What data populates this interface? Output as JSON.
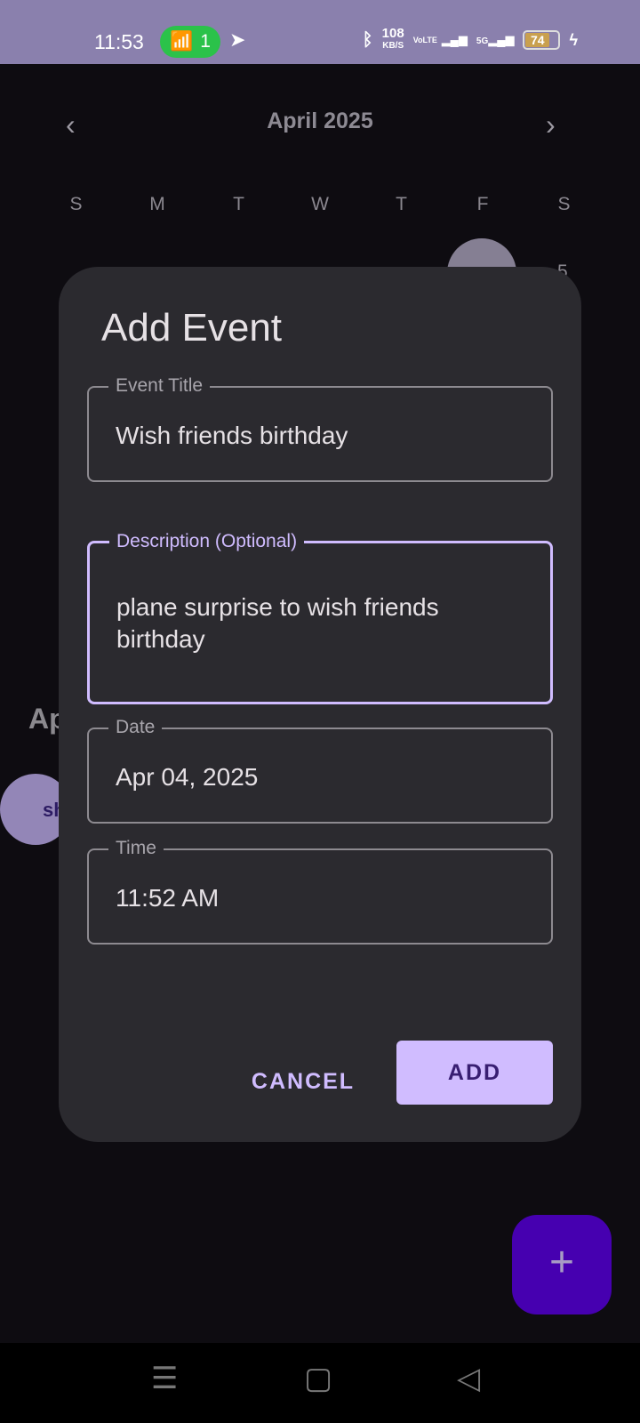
{
  "status_bar": {
    "time": "11:53",
    "hotspot_count": "1",
    "net_speed": "108",
    "net_unit": "KB/S",
    "volte": "VoLTE",
    "signal_5g": "5G",
    "battery": "74"
  },
  "calendar": {
    "month": "April 2025",
    "weekdays": [
      "S",
      "M",
      "T",
      "W",
      "T",
      "F",
      "S"
    ],
    "visible_day": "5",
    "section_title_partial": "Ap",
    "chip_partial": "sh"
  },
  "dialog": {
    "title": "Add Event",
    "fields": [
      {
        "label": "Event Title",
        "value": "Wish friends birthday"
      },
      {
        "label": "Description (Optional)",
        "value": "plane surprise to wish friends birthday"
      },
      {
        "label": "Date",
        "value": "Apr 04, 2025"
      },
      {
        "label": "Time",
        "value": "11:52 AM"
      }
    ],
    "cancel": "CANCEL",
    "add": "ADD"
  },
  "fab": "+",
  "nav": {
    "menu": "☰",
    "home": "▢",
    "back": "◁"
  }
}
